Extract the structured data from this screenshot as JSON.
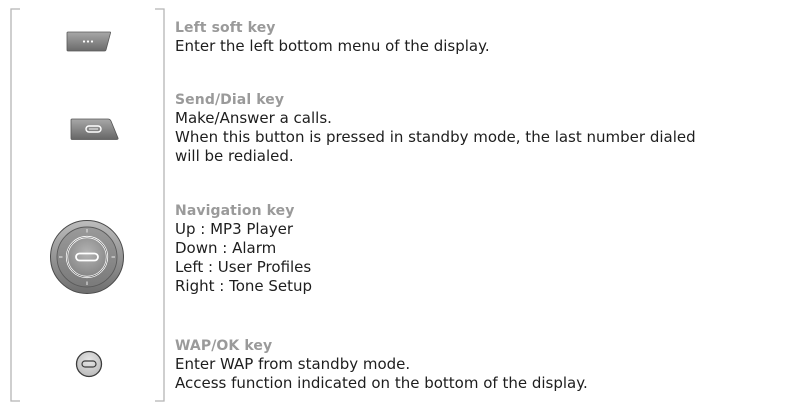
{
  "keys": [
    {
      "icon": "left-soft-key-icon",
      "title": "Left soft key",
      "lines": [
        "Enter the left bottom menu of the display."
      ]
    },
    {
      "icon": "send-dial-key-icon",
      "title": "Send/Dial key",
      "lines": [
        "Make/Answer a calls.",
        "When this button is pressed in standby mode, the last number dialed",
        "will be redialed."
      ]
    },
    {
      "icon": "navigation-key-icon",
      "title": "Navigation key",
      "lines": [
        "Up : MP3 Player",
        "Down : Alarm",
        "Left : User Profiles",
        "Right : Tone Setup"
      ]
    },
    {
      "icon": "wap-ok-key-icon",
      "title": "WAP/OK key",
      "lines": [
        "Enter WAP from standby mode.",
        "Access function indicated on the bottom of the display."
      ]
    }
  ],
  "colors": {
    "title": "#9a9a9a",
    "body_text": "#1e1e1e",
    "bracket": "#b5b5b5",
    "key_fill": "#8c8c8c"
  }
}
